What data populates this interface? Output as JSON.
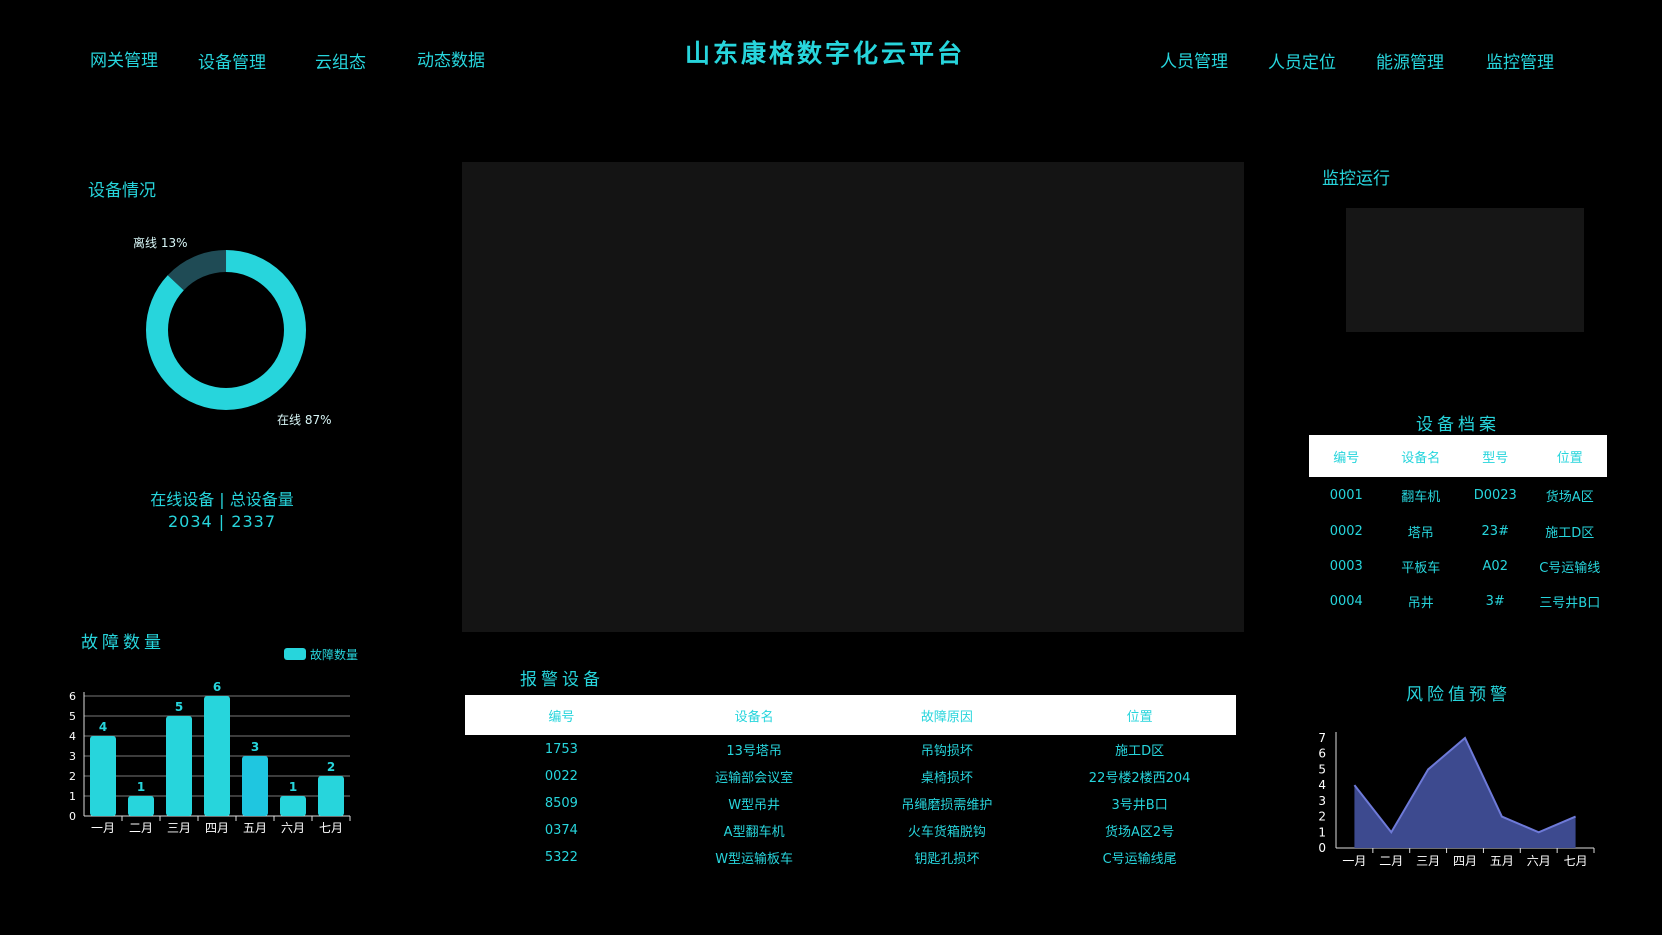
{
  "header": {
    "title": "山东康格数字化云平台",
    "nav_left": [
      "网关管理",
      "设备管理",
      "云组态",
      "动态数据"
    ],
    "nav_right": [
      "人员管理",
      "人员定位",
      "能源管理",
      "监控管理"
    ]
  },
  "device_status": {
    "title": "设备情况",
    "offline_label": "离线 13%",
    "online_label": "在线 87%",
    "online_percent": 87,
    "offline_percent": 13,
    "summary_label": "在线设备 | 总设备量",
    "summary_value": "2034 | 2337"
  },
  "fault_chart": {
    "title": "故障数量",
    "legend": "故障数量"
  },
  "monitor": {
    "title": "监控运行"
  },
  "archive": {
    "title": "设备档案",
    "columns": [
      "编号",
      "设备名",
      "型号",
      "位置"
    ],
    "rows": [
      [
        "0001",
        "翻车机",
        "D0023",
        "货场A区"
      ],
      [
        "0002",
        "塔吊",
        "23#",
        "施工D区"
      ],
      [
        "0003",
        "平板车",
        "A02",
        "C号运输线"
      ],
      [
        "0004",
        "吊井",
        "3#",
        "三号井B口"
      ]
    ]
  },
  "alarm": {
    "title": "报警设备",
    "columns": [
      "编号",
      "设备名",
      "故障原因",
      "位置"
    ],
    "rows": [
      [
        "1753",
        "13号塔吊",
        "吊钩损坏",
        "施工D区"
      ],
      [
        "0022",
        "运输部会议室",
        "桌椅损坏",
        "22号楼2楼西204"
      ],
      [
        "8509",
        "W型吊井",
        "吊绳磨损需维护",
        "3号井B口"
      ],
      [
        "0374",
        "A型翻车机",
        "火车货箱脱钩",
        "货场A区2号"
      ],
      [
        "5322",
        "W型运输板车",
        "钥匙孔损坏",
        "C号运输线尾"
      ]
    ]
  },
  "risk_chart": {
    "title": "风险值预警"
  },
  "colors": {
    "accent": "#27d5dc",
    "bar_alt": "#1fc6e0",
    "donut_dark": "#1f4b55",
    "area_fill": "#3d4a8f",
    "area_line": "#6e7ad8",
    "panel": "#141414"
  },
  "chart_data": [
    {
      "type": "bar",
      "categories": [
        "一月",
        "二月",
        "三月",
        "四月",
        "五月",
        "六月",
        "七月"
      ],
      "series": [
        {
          "name": "故障数量",
          "values": [
            4,
            1,
            5,
            6,
            3,
            1,
            2
          ]
        }
      ],
      "ylim": [
        0,
        6
      ],
      "yticks": [
        0,
        1,
        2,
        3,
        4,
        5,
        6
      ],
      "grid": true,
      "legend": "top-right"
    },
    {
      "type": "area",
      "categories": [
        "一月",
        "二月",
        "三月",
        "四月",
        "五月",
        "六月",
        "七月"
      ],
      "series": [
        {
          "values": [
            4,
            1,
            5,
            7,
            2,
            1,
            2
          ]
        }
      ],
      "ylim": [
        0,
        7
      ],
      "yticks": [
        0,
        1,
        2,
        3,
        4,
        5,
        6,
        7
      ],
      "grid": false
    }
  ]
}
